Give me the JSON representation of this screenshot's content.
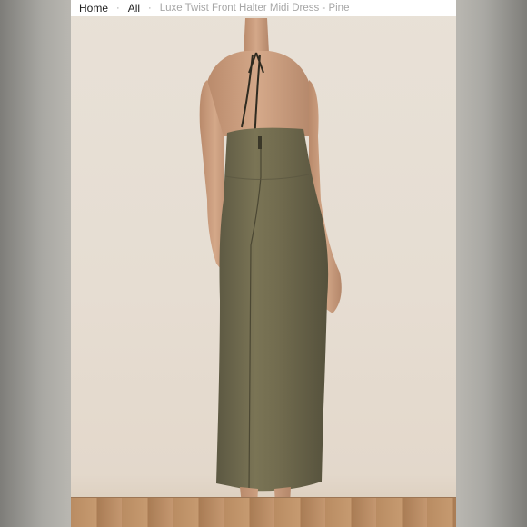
{
  "breadcrumb": {
    "home_label": "Home",
    "separator": "·",
    "all_label": "All",
    "current_label": "Luxe Twist Front Halter Midi Dress - Pine"
  },
  "product_image": {
    "subject": "Luxe Twist Front Halter Midi Dress - Pine",
    "dress_color": "#6f6a4f"
  }
}
